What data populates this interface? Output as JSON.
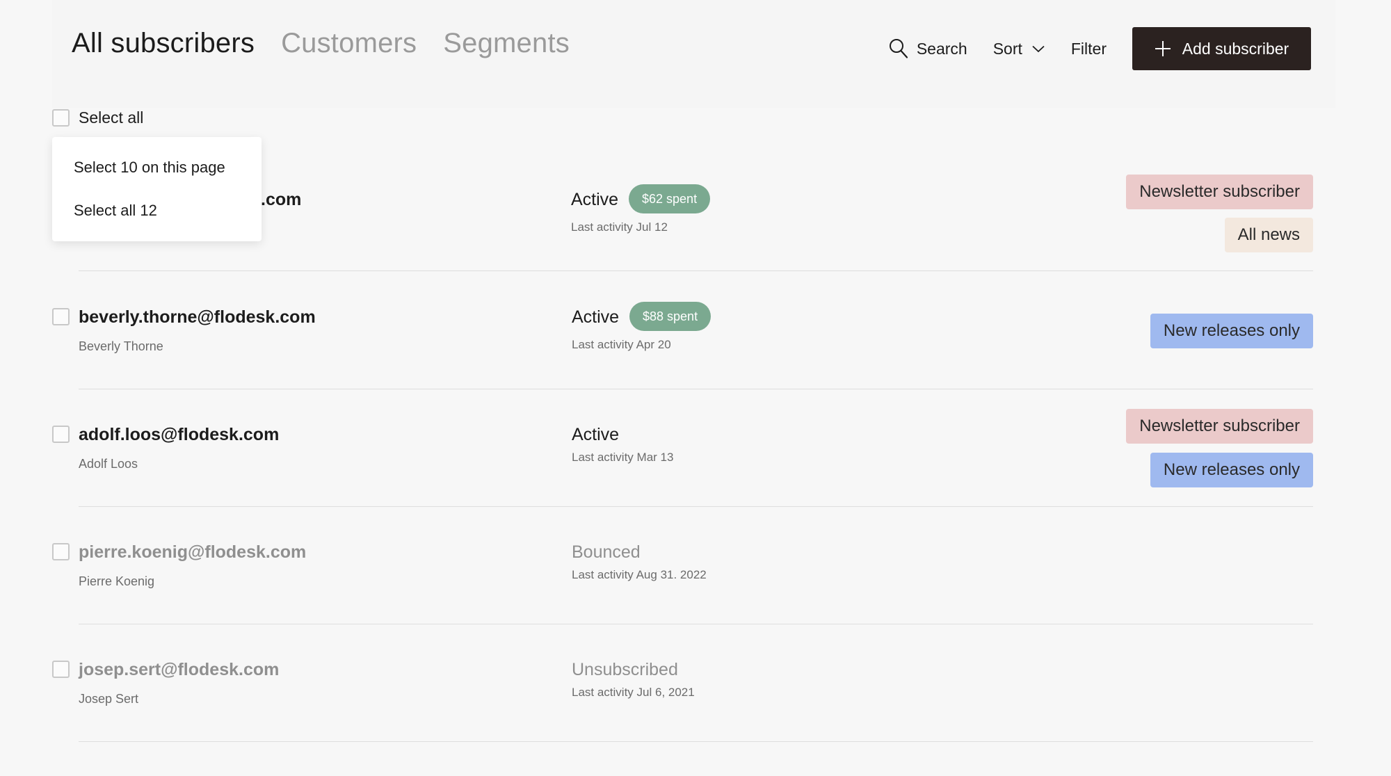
{
  "header": {
    "tabs": [
      {
        "label": "All subscribers",
        "active": true
      },
      {
        "label": "Customers",
        "active": false
      },
      {
        "label": "Segments",
        "active": false
      }
    ],
    "search_label": "Search",
    "sort_label": "Sort",
    "filter_label": "Filter",
    "add_label": "Add subscriber"
  },
  "select_all": {
    "label": "Select all",
    "menu": [
      "Select 10 on this page",
      "Select all 12"
    ]
  },
  "colors": {
    "tag_newsletter": "#ebcaca",
    "tag_all_news": "#f3e8de",
    "tag_new_releases": "#9fb9ef",
    "spent_badge": "#7ba990",
    "primary_button": "#2b2220"
  },
  "subscribers": [
    {
      "email_suffix": ".com",
      "name": "",
      "status": "Active",
      "spent": "$62 spent",
      "activity": "Last activity Jul 12",
      "tags": [
        "Newsletter subscriber",
        "All news"
      ]
    },
    {
      "email": "beverly.thorne@flodesk.com",
      "name": "Beverly Thorne",
      "status": "Active",
      "spent": "$88 spent",
      "activity": "Last activity Apr 20",
      "tags": [
        "New releases only"
      ]
    },
    {
      "email": "adolf.loos@flodesk.com",
      "name": "Adolf Loos",
      "status": "Active",
      "activity": "Last activity Mar 13",
      "tags": [
        "Newsletter subscriber",
        "New releases only"
      ]
    },
    {
      "email": "pierre.koenig@flodesk.com",
      "name": "Pierre Koenig",
      "status": "Bounced",
      "activity": "Last activity Aug 31. 2022",
      "tags": []
    },
    {
      "email": "josep.sert@flodesk.com",
      "name": "Josep Sert",
      "status": "Unsubscribed",
      "activity": "Last activity Jul 6, 2021",
      "tags": []
    }
  ]
}
